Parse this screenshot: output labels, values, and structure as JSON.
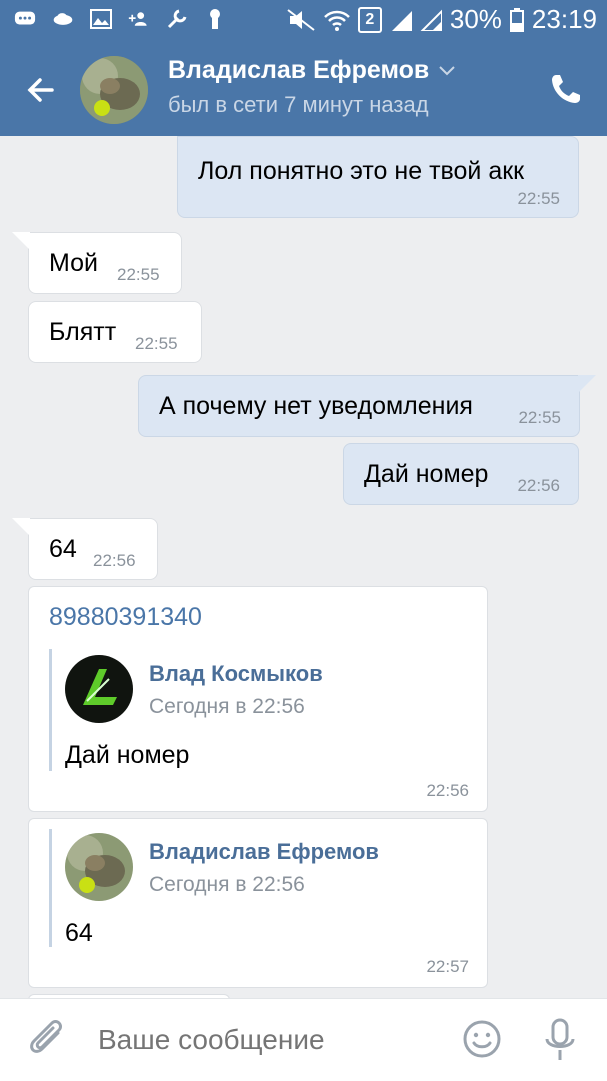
{
  "status_bar": {
    "battery_percent": "30%",
    "clock": "23:19",
    "sim_slot": "2"
  },
  "header": {
    "contact_name": "Владислав Ефремов",
    "last_seen": "был в сети 7 минут назад"
  },
  "messages": [
    {
      "text": "Лол понятно это не твой акк",
      "time": "22:55",
      "dir": "out"
    },
    {
      "text": "Мой",
      "time": "22:55",
      "dir": "in"
    },
    {
      "text": "Блятт",
      "time": "22:55",
      "dir": "in"
    },
    {
      "text": "А почему нет уведомления",
      "time": "22:55",
      "dir": "out"
    },
    {
      "text": "Дай номер",
      "time": "22:56",
      "dir": "out"
    },
    {
      "text": "64",
      "time": "22:56",
      "dir": "in"
    }
  ],
  "card1": {
    "text": "89880391340",
    "time": "22:56",
    "fwd": {
      "name": "Влад Космыков",
      "date": "Сегодня в 22:56",
      "text": "Дай номер"
    }
  },
  "card2": {
    "time": "22:57",
    "fwd": {
      "name": "Владислав Ефремов",
      "date": "Сегодня в 22:56",
      "text": "64"
    }
  },
  "composer": {
    "placeholder": "Ваше сообщение"
  },
  "colors": {
    "accent": "#4a76a8",
    "outgoing_bubble": "#dce6f3",
    "incoming_bubble": "#ffffff"
  }
}
